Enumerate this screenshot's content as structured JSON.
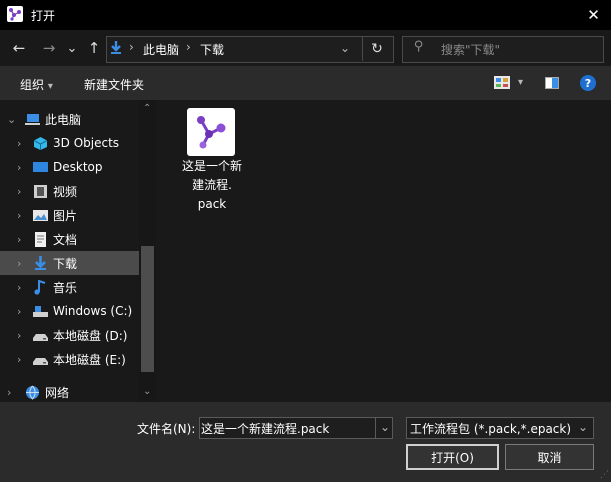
{
  "window": {
    "title": "打开",
    "close_glyph": "✕"
  },
  "nav": {
    "back_glyph": "←",
    "forward_glyph": "→",
    "recent_glyph": "⌄",
    "up_glyph": "↑",
    "breadcrumb": [
      "此电脑",
      "下载"
    ],
    "separator": "›",
    "refresh_glyph": "↻",
    "search_placeholder": "搜索\"下载\"",
    "search_glyph": "⚲"
  },
  "toolbar": {
    "organize_label": "组织",
    "new_folder_label": "新建文件夹",
    "help_glyph": "?"
  },
  "sidebar": {
    "items": [
      {
        "label": "此电脑",
        "icon": "computer-icon",
        "expanded": true
      },
      {
        "label": "3D Objects",
        "icon": "3d-objects-icon"
      },
      {
        "label": "Desktop",
        "icon": "desktop-icon"
      },
      {
        "label": "视频",
        "icon": "videos-icon"
      },
      {
        "label": "图片",
        "icon": "pictures-icon"
      },
      {
        "label": "文档",
        "icon": "documents-icon"
      },
      {
        "label": "下载",
        "icon": "downloads-icon",
        "selected": true
      },
      {
        "label": "音乐",
        "icon": "music-icon"
      },
      {
        "label": "Windows (C:)",
        "icon": "system-drive-icon"
      },
      {
        "label": "本地磁盘 (D:)",
        "icon": "drive-icon"
      },
      {
        "label": "本地磁盘 (E:)",
        "icon": "drive-icon"
      },
      {
        "label": "网络",
        "icon": "network-icon"
      }
    ]
  },
  "files": [
    {
      "name_lines": [
        "这是一个新",
        "建流程.",
        "pack"
      ],
      "icon": "workflow-pack-icon"
    }
  ],
  "footer": {
    "filename_label": "文件名(N):",
    "filename_value": "这是一个新建流程.pack",
    "filetype_value": "工作流程包 (*.pack,*.epack)",
    "open_label": "打开(O)",
    "cancel_label": "取消"
  },
  "colors": {
    "accent": "#1e90ff",
    "selected_bg": "#4b4b4b",
    "app_purple": "#7b3fc4"
  }
}
